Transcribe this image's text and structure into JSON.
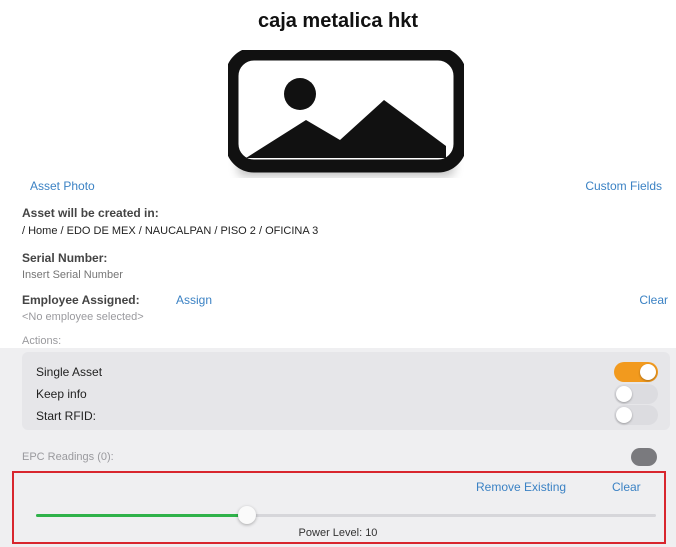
{
  "header": {
    "title": "caja metalica hkt"
  },
  "asset_photo_icon": "image-placeholder-icon",
  "links": {
    "asset_photo": "Asset Photo",
    "custom_fields": "Custom Fields"
  },
  "location": {
    "label": "Asset will be created in:",
    "path": "/ Home / EDO DE  MEX / NAUCALPAN / PISO 2 / OFICINA 3"
  },
  "serial": {
    "label": "Serial Number:",
    "placeholder": "Insert Serial Number"
  },
  "employee": {
    "label": "Employee Assigned:",
    "assign": "Assign",
    "clear": "Clear",
    "value": "<No employee selected>"
  },
  "actions": {
    "label": "Actions:",
    "items": [
      {
        "label": "Single Asset",
        "on": true
      },
      {
        "label": "Keep info",
        "on": false
      },
      {
        "label": "Start RFID:",
        "on": false
      }
    ]
  },
  "epc": {
    "label": "EPC Readings (0):"
  },
  "power": {
    "remove_existing": "Remove Existing",
    "clear": "Clear",
    "label": "Power Level: 10",
    "level_fraction": 0.34
  },
  "colors": {
    "accent": "#3b82c4",
    "toggle_on": "#f29a1e",
    "slider_fill": "#2fb24a",
    "highlight_border": "#d8262e"
  }
}
